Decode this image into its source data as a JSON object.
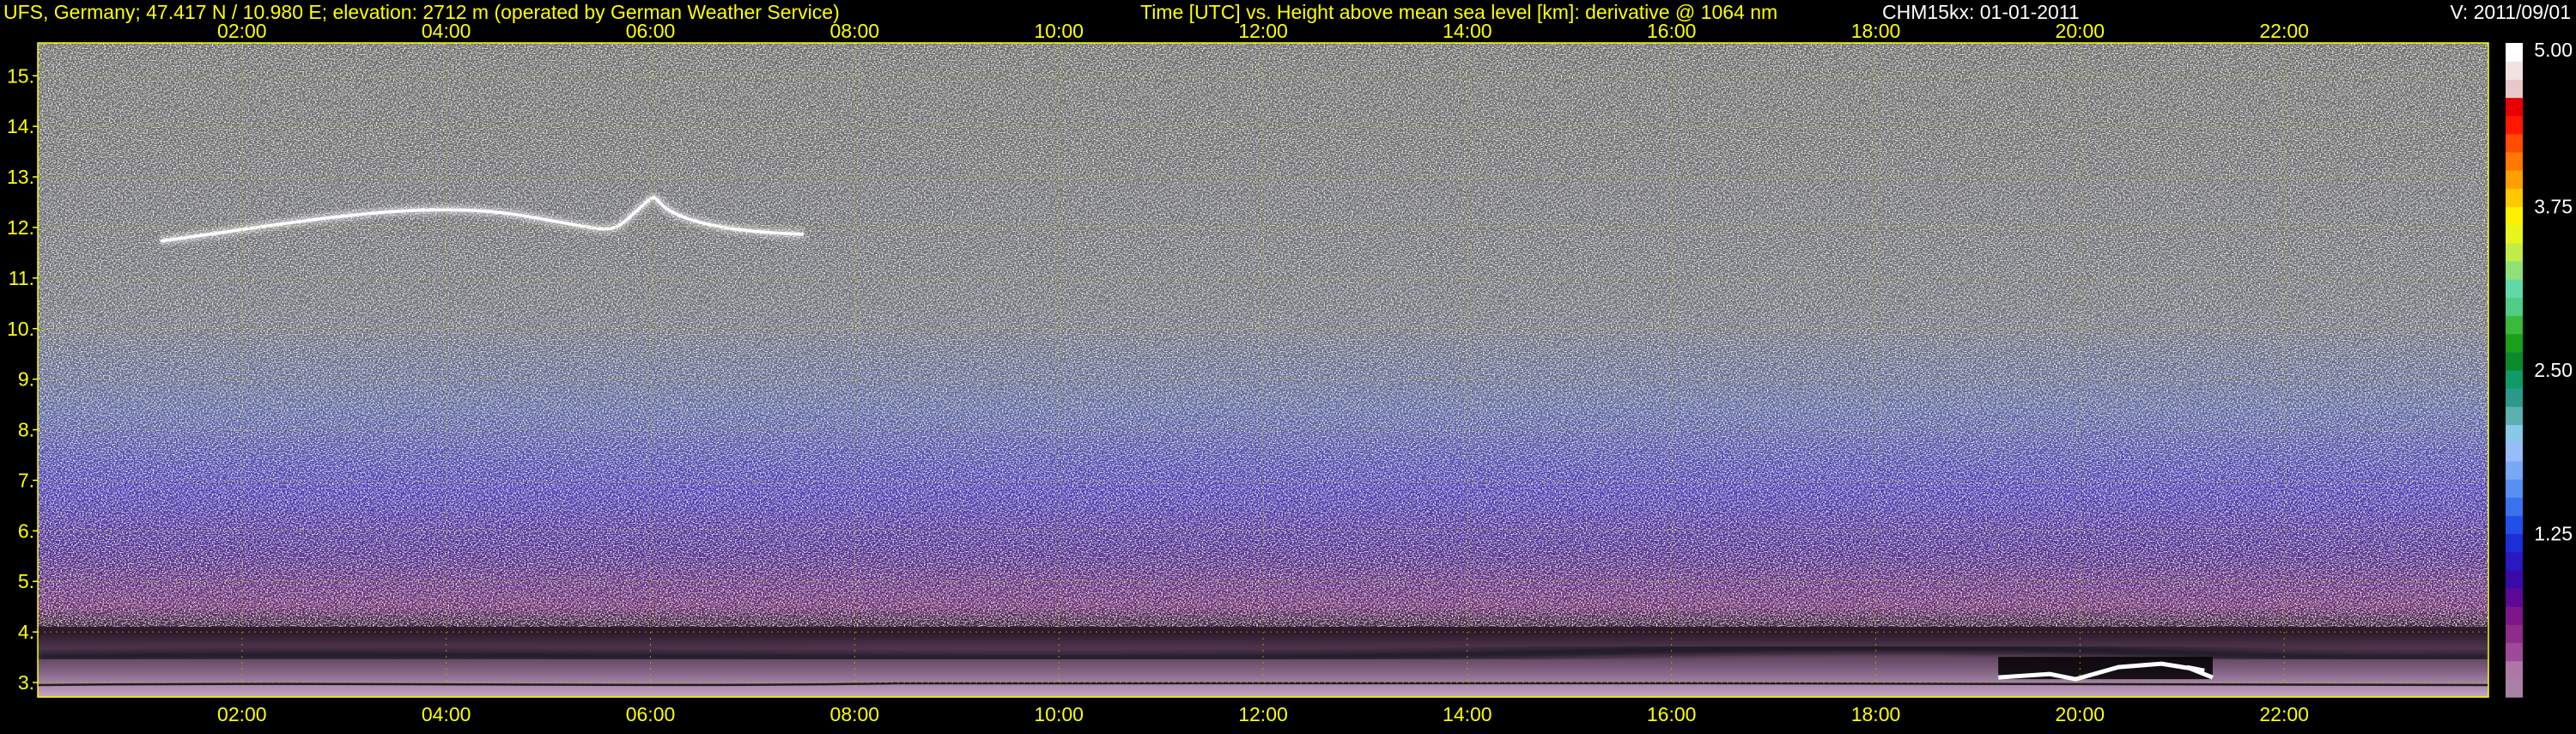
{
  "header": {
    "site": "UFS, Germany; 47.417 N / 10.980 E; elevation: 2712 m  (operated by German Weather Service)",
    "description": "Time [UTC] vs. Height above mean sea level [km]: derivative @ 1064 nm",
    "instrument": "CHM15kx: 01-01-2011",
    "version": "V: 2011/09/01"
  },
  "colors": {
    "text": "#ffff00",
    "grid": "#b8b800",
    "frame": "#ffff00",
    "background": "#000000"
  },
  "chart_data": {
    "type": "heatmap",
    "x": {
      "range_hours": [
        0,
        24
      ],
      "ticks": [
        2,
        4,
        6,
        8,
        10,
        12,
        14,
        16,
        18,
        20,
        22
      ],
      "tick_labels": [
        "02:00",
        "04:00",
        "06:00",
        "08:00",
        "10:00",
        "12:00",
        "14:00",
        "16:00",
        "18:00",
        "20:00",
        "22:00"
      ],
      "ticks_on": [
        "top",
        "bottom"
      ]
    },
    "y": {
      "range_km": [
        2.712,
        15.65
      ],
      "ticks": [
        3,
        4,
        5,
        6,
        7,
        8,
        9,
        10,
        11,
        12,
        13,
        14,
        15
      ],
      "tick_labels": [
        "3.",
        "4.",
        "5.",
        "6.",
        "7.",
        "8.",
        "9.",
        "10.",
        "11.",
        "12.",
        "13.",
        "14.",
        "15."
      ]
    },
    "colorbar": {
      "range": [
        0,
        5
      ],
      "ticks": [
        1.25,
        2.5,
        3.75,
        5.0
      ],
      "tick_labels": [
        "1.25",
        "2.50",
        "3.75",
        "5.00"
      ],
      "colors": [
        "#a882a6",
        "#ae78a6",
        "#9e4a98",
        "#8e2c8a",
        "#7c168a",
        "#5c0898",
        "#3a0aa8",
        "#2a18c0",
        "#1c2ed6",
        "#2250e6",
        "#3a72ee",
        "#5890f2",
        "#78a8f6",
        "#98bcf8",
        "#88c8e8",
        "#5cb0b0",
        "#2c9a8a",
        "#109a68",
        "#0c8a2a",
        "#18a018",
        "#3cb83c",
        "#50cc84",
        "#60d8a8",
        "#90e078",
        "#c0ec48",
        "#e8f420",
        "#fff200",
        "#ffc800",
        "#ffa000",
        "#ff7800",
        "#ff4c00",
        "#ff1800",
        "#e80000",
        "#e8c8c8",
        "#f2e2e2",
        "#ffffff"
      ]
    },
    "grid": true,
    "features": [
      {
        "kind": "cirrus",
        "t_start": 1.2,
        "t_end": 7.5,
        "height_km": 11.9
      },
      {
        "kind": "boundary-layer-top",
        "t_start": 0,
        "t_end": 24,
        "height_km": 3.5
      },
      {
        "kind": "low-cloud",
        "t_start": 19.2,
        "t_end": 21.3,
        "height_km": 3.1
      }
    ]
  }
}
